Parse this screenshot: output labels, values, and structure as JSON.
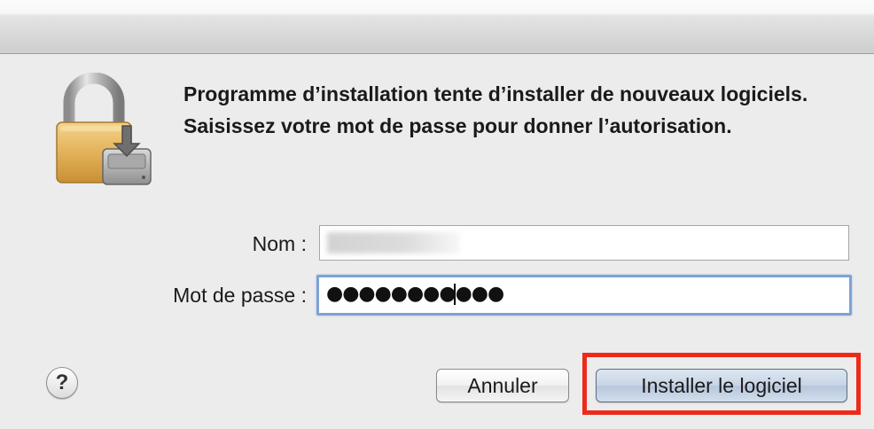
{
  "dialog": {
    "message": "Programme d’installation tente d’installer de nouveaux logiciels. Saisissez votre mot de passe pour donner l’autorisation.",
    "icon": "lock-with-disk-icon"
  },
  "form": {
    "name_label": "Nom :",
    "name_value": "",
    "password_label": "Mot de passe :",
    "password_mask": "●●●●●●●●●●●"
  },
  "buttons": {
    "help_label": "?",
    "cancel_label": "Annuler",
    "install_label": "Installer le logiciel"
  },
  "colors": {
    "highlight": "#ee2a1b",
    "focus_ring": "#7ea3d3"
  }
}
